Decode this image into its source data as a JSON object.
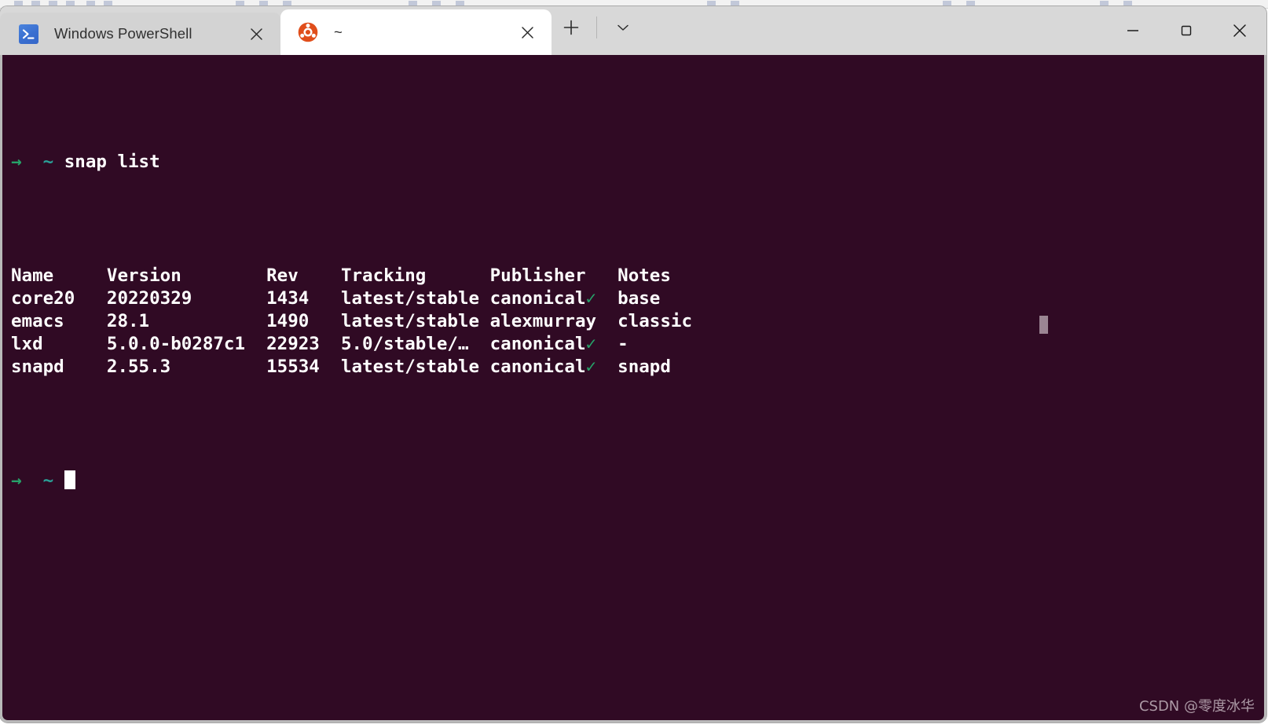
{
  "window": {
    "controls": {
      "minimize_label": "Minimize",
      "maximize_label": "Maximize",
      "close_label": "Close"
    }
  },
  "tabbar": {
    "tabs": [
      {
        "title": "Windows PowerShell",
        "icon": "powershell-icon",
        "active": false,
        "close_label": "Close tab"
      },
      {
        "title": "~",
        "icon": "ubuntu-icon",
        "active": true,
        "close_label": "Close tab"
      }
    ],
    "new_tab_label": "+",
    "dropdown_label": "v"
  },
  "terminal": {
    "background": "#300a24",
    "foreground": "#ffffff",
    "prompt": {
      "arrow": "→",
      "path": "~",
      "arrow_color": "#26a269",
      "path_color": "#2aa198"
    },
    "command": "snap list",
    "table": {
      "headers": [
        "Name",
        "Version",
        "Rev",
        "Tracking",
        "Publisher",
        "Notes"
      ],
      "rows": [
        {
          "name": "core20",
          "version": "20220329",
          "rev": "1434",
          "tracking": "latest/stable",
          "publisher": "canonical",
          "verified": true,
          "notes": "base"
        },
        {
          "name": "emacs",
          "version": "28.1",
          "rev": "1490",
          "tracking": "latest/stable",
          "publisher": "alexmurray",
          "verified": false,
          "notes": "classic"
        },
        {
          "name": "lxd",
          "version": "5.0.0-b0287c1",
          "rev": "22923",
          "tracking": "5.0/stable/…",
          "publisher": "canonical",
          "verified": true,
          "notes": "-"
        },
        {
          "name": "snapd",
          "version": "2.55.3",
          "rev": "15534",
          "tracking": "latest/stable",
          "publisher": "canonical",
          "verified": true,
          "notes": "snapd"
        }
      ]
    },
    "verified_glyph": "✓",
    "cursor": "block"
  },
  "watermark": {
    "text": "CSDN @零度冰华"
  }
}
